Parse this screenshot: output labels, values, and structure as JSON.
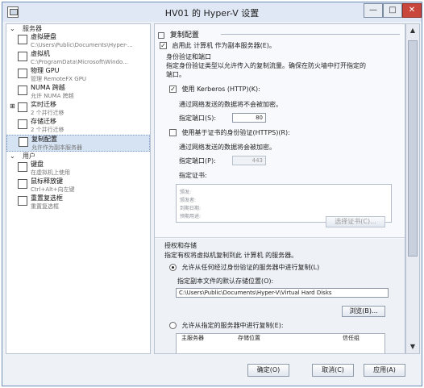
{
  "window": {
    "title": "HV01 的 Hyper-V 设置",
    "controls": [
      "minimize-icon",
      "maximize-icon",
      "close-icon"
    ]
  },
  "nav": {
    "sections": [
      {
        "label": "服务器"
      },
      {
        "label": "用户"
      }
    ],
    "server_items": [
      {
        "label": "虚拟硬盘",
        "desc": "C:\\Users\\Public\\Documents\\Hyper-..."
      },
      {
        "label": "虚拟机",
        "desc": "C:\\ProgramData\\Microsoft\\Windo..."
      },
      {
        "label": "物理 GPU",
        "desc": "管理 RemoteFX GPU"
      },
      {
        "label": "NUMA 跨越",
        "desc": "允许 NUMA 跨越"
      },
      {
        "label": "实时迁移",
        "desc": "2 个并行迁移"
      },
      {
        "label": "存储迁移",
        "desc": "2 个并行迁移"
      },
      {
        "label": "复制配置",
        "desc": "允许作为副本服务器"
      }
    ],
    "user_items": [
      {
        "label": "键盘",
        "desc": "在虚拟机上使用"
      },
      {
        "label": "鼠标释放键",
        "desc": "Ctrl+Alt+向左键"
      },
      {
        "label": "重置复选框",
        "desc": "重置复选框"
      }
    ]
  },
  "pane": {
    "title": "复制配置",
    "enable_replica": "启用此 计算机 作为副本服务器(E)。",
    "auth_title": "身份验证和端口",
    "auth_desc1": "指定身份验证类型以允许传入的复制流量。确保在防火墙中打开指定的",
    "auth_desc2": "端口。",
    "kerberos_label": "使用 Kerberos (HTTP)(K):",
    "kerberos_note": "通过网络发送的数据将不会被加密。",
    "port_label": "指定端口(S):",
    "kerberos_port": "80",
    "cert_label": "使用基于证书的身份验证(HTTPS)(R):",
    "cert_note": "通过网络发送的数据将会被加密。",
    "cert_port_label": "指定端口(P):",
    "cert_port": "443",
    "cert_spec_label": "指定证书:",
    "cert_lines": [
      "颁发:",
      "颁发者:",
      "到期日期:",
      "预期用途:"
    ],
    "select_cert_button": "选择证书(C)...",
    "storage_title": "授权和存储",
    "storage_desc": "指定有权将虚拟机复制到此 计算机 的服务器。",
    "allow_any": "允许从任何经过身份验证的服务器中进行复制(L)",
    "default_location_label": "指定副本文件的默认存储位置(O):",
    "default_location": "C:\\Users\\Public\\Documents\\Hyper-V\\Virtual Hard Disks",
    "browse_button": "浏览(B)...",
    "allow_specified": "允许从指定的服务器中进行复制(E):",
    "table_headers": [
      "主服务器",
      "存储位置",
      "信任组"
    ]
  },
  "footer": {
    "ok": "确定(O)",
    "cancel": "取消(C)",
    "apply": "应用(A)"
  }
}
